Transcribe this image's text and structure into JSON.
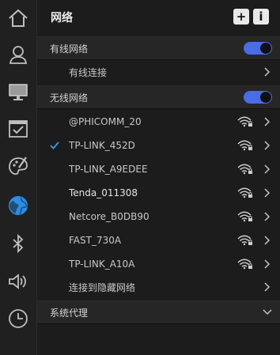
{
  "sidebar": {
    "items": [
      {
        "name": "home-icon"
      },
      {
        "name": "account-icon"
      },
      {
        "name": "display-icon"
      },
      {
        "name": "default-apps-icon"
      },
      {
        "name": "personalization-icon"
      },
      {
        "name": "network-icon",
        "active": true
      },
      {
        "name": "bluetooth-icon"
      },
      {
        "name": "sound-icon"
      },
      {
        "name": "time-icon"
      }
    ]
  },
  "header": {
    "title": "网络",
    "add_label": "+",
    "info_label": "i"
  },
  "wired": {
    "section_label": "有线网络",
    "enabled": true,
    "connection_label": "有线连接"
  },
  "wireless": {
    "section_label": "无线网络",
    "enabled": true,
    "networks": [
      {
        "ssid": "@PHICOMM_20",
        "connected": false
      },
      {
        "ssid": "TP-LINK_452D",
        "connected": true
      },
      {
        "ssid": "TP-LINK_A9EDEE",
        "connected": false
      },
      {
        "ssid": "Tenda_011308",
        "connected": false
      },
      {
        "ssid": "Netcore_B0DB90",
        "connected": false
      },
      {
        "ssid": "FAST_730A",
        "connected": false
      },
      {
        "ssid": "TP-LINK_A10A",
        "connected": false
      }
    ],
    "hidden_label": "连接到隐藏网络"
  },
  "proxy": {
    "section_label": "系统代理"
  },
  "colors": {
    "accent": "#4a6ce8",
    "check": "#3d9be9",
    "active_icon": "#2b8de5"
  }
}
